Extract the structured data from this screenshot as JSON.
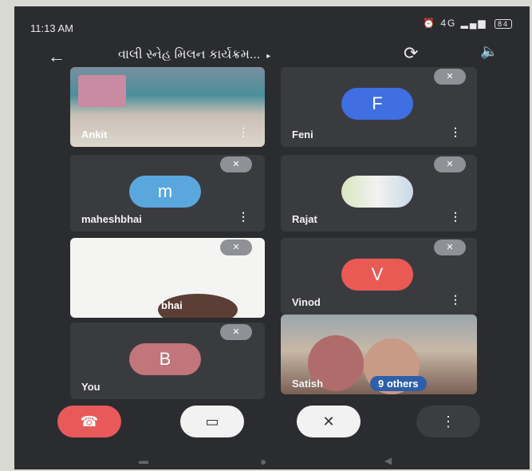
{
  "status": {
    "time": "11:13 AM",
    "signal": "4G",
    "battery": "84"
  },
  "header": {
    "title": "વાલી સ્નેહ મિલન કાર્યક્રમ...",
    "caret": "▸"
  },
  "participants": [
    {
      "name": "Ankit",
      "initial": "",
      "color": ""
    },
    {
      "name": "Feni",
      "initial": "F",
      "color": "#3f6fe0"
    },
    {
      "name": "maheshbhai",
      "initial": "m",
      "color": "#5aa7de"
    },
    {
      "name": "Rajat",
      "initial": "",
      "color": ""
    },
    {
      "name": "bhai",
      "initial": "",
      "color": ""
    },
    {
      "name": "Vinod",
      "initial": "V",
      "color": "#ea5a55"
    },
    {
      "name": "You",
      "initial": "B",
      "color": "#c2757a"
    },
    {
      "name": "Satish",
      "initial": "",
      "color": ""
    }
  ],
  "others_badge": "9 others",
  "icons": {
    "menu": "⋮",
    "mute": "mic-off",
    "back": "←"
  },
  "colors": {
    "end_call": "#e85a5a",
    "background": "#2b2c2f"
  }
}
